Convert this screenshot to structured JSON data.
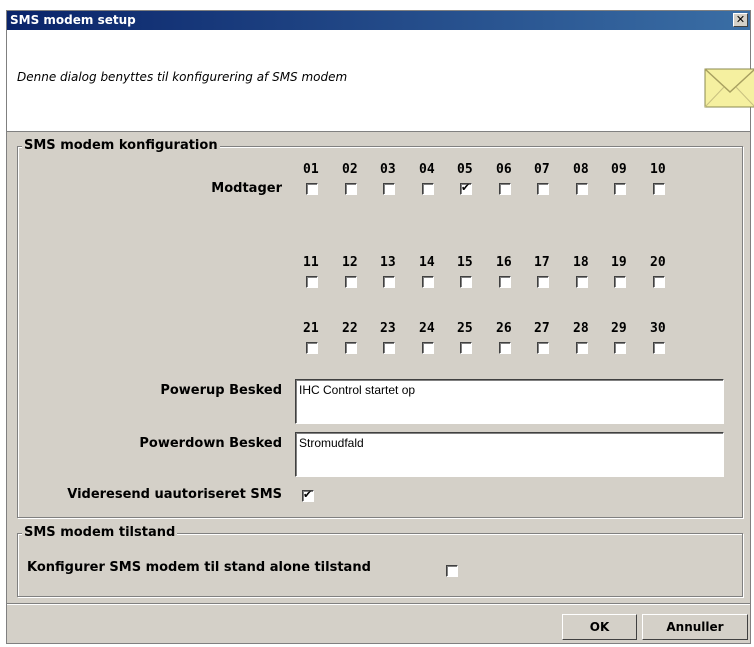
{
  "window": {
    "title": "SMS modem setup",
    "close_glyph": "✕"
  },
  "header": {
    "description": "Denne dialog benyttes til konfigurering af SMS modem",
    "icon": "envelope-icon"
  },
  "config_group": {
    "title": "SMS modem konfiguration",
    "receiver_label": "Modtager",
    "receivers": [
      {
        "num": "01",
        "checked": false
      },
      {
        "num": "02",
        "checked": false
      },
      {
        "num": "03",
        "checked": false
      },
      {
        "num": "04",
        "checked": false
      },
      {
        "num": "05",
        "checked": true
      },
      {
        "num": "06",
        "checked": false
      },
      {
        "num": "07",
        "checked": false
      },
      {
        "num": "08",
        "checked": false
      },
      {
        "num": "09",
        "checked": false
      },
      {
        "num": "10",
        "checked": false
      },
      {
        "num": "11",
        "checked": false
      },
      {
        "num": "12",
        "checked": false
      },
      {
        "num": "13",
        "checked": false
      },
      {
        "num": "14",
        "checked": false
      },
      {
        "num": "15",
        "checked": false
      },
      {
        "num": "16",
        "checked": false
      },
      {
        "num": "17",
        "checked": false
      },
      {
        "num": "18",
        "checked": false
      },
      {
        "num": "19",
        "checked": false
      },
      {
        "num": "20",
        "checked": false
      },
      {
        "num": "21",
        "checked": false
      },
      {
        "num": "22",
        "checked": false
      },
      {
        "num": "23",
        "checked": false
      },
      {
        "num": "24",
        "checked": false
      },
      {
        "num": "25",
        "checked": false
      },
      {
        "num": "26",
        "checked": false
      },
      {
        "num": "27",
        "checked": false
      },
      {
        "num": "28",
        "checked": false
      },
      {
        "num": "29",
        "checked": false
      },
      {
        "num": "30",
        "checked": false
      }
    ],
    "powerup_label": "Powerup Besked",
    "powerup_value": "IHC Control startet op",
    "powerdown_label": "Powerdown Besked",
    "powerdown_value": "Stromudfald",
    "forward_label": "Videresend uautoriseret SMS",
    "forward_checked": true
  },
  "state_group": {
    "title": "SMS modem tilstand",
    "standalone_label": "Konfigurer SMS modem til stand alone tilstand",
    "standalone_checked": false
  },
  "buttons": {
    "ok": "OK",
    "cancel": "Annuller"
  },
  "colors": {
    "titlebar": "#0a246a",
    "dialog_bg": "#d4d0c8",
    "envelope": "#f5f0a0"
  }
}
